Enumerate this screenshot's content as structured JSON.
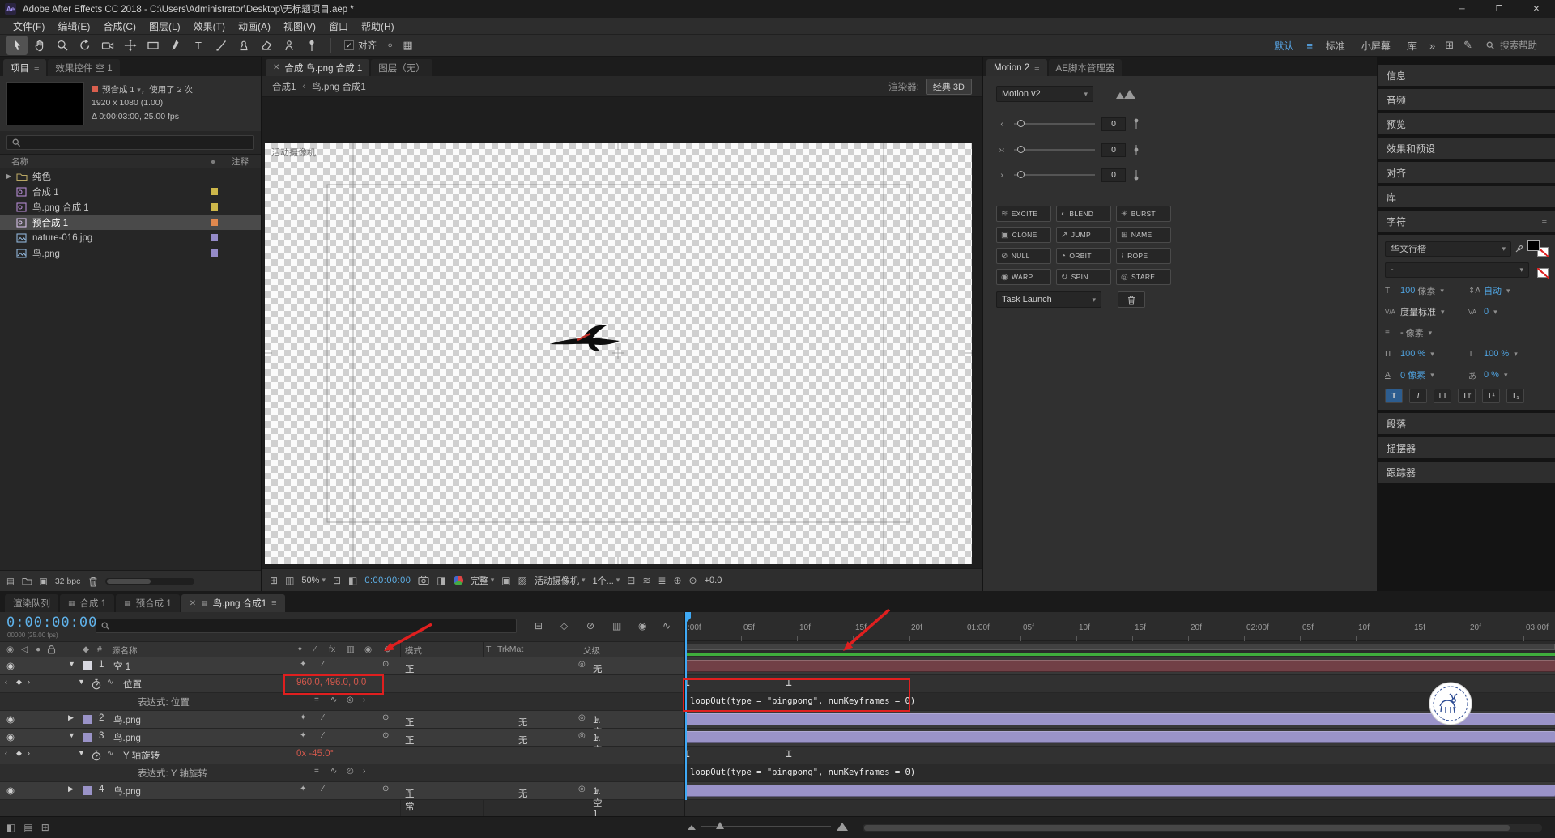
{
  "window": {
    "title": "Adobe After Effects CC 2018 - C:\\Users\\Administrator\\Desktop\\无标题项目.aep *",
    "app_badge": "Ae"
  },
  "menu": {
    "items": [
      "文件(F)",
      "编辑(E)",
      "合成(C)",
      "图层(L)",
      "效果(T)",
      "动画(A)",
      "视图(V)",
      "窗口",
      "帮助(H)"
    ]
  },
  "toolbar": {
    "snap_label": "对齐",
    "workspaces": [
      "默认",
      "标准",
      "小屏幕",
      "库"
    ],
    "overflow": "»",
    "search_placeholder": "搜索帮助"
  },
  "project": {
    "tab_project": "项目",
    "tab_effects": "效果控件 空 1",
    "info": {
      "chip": "#d95f4e",
      "name": "预合成 1",
      "usage": "，使用了 2 次",
      "line2": "1920 x 1080 (1.00)",
      "line3": "Δ 0:00:03:00, 25.00 fps"
    },
    "columns": {
      "name": "名称",
      "comment": "注释"
    },
    "items": [
      {
        "name": "纯色",
        "type": "folder",
        "chip": ""
      },
      {
        "name": "合成 1",
        "type": "comp",
        "chip": "#cdb74a"
      },
      {
        "name": "鸟.png 合成 1",
        "type": "comp",
        "chip": "#cdb74a"
      },
      {
        "name": "预合成 1",
        "type": "comp",
        "chip": "#e0884e"
      },
      {
        "name": "nature-016.jpg",
        "type": "image",
        "chip": "#958bc8"
      },
      {
        "name": "鸟.png",
        "type": "image",
        "chip": "#958bc8"
      }
    ],
    "footer": {
      "bpc": "32 bpc"
    }
  },
  "viewer": {
    "tab1": "合成 鸟.png 合成 1",
    "tab2": "图层（无）",
    "crumb1": "合成1",
    "crumb2": "鸟.png 合成1",
    "renderer_label": "渲染器:",
    "renderer_value": "经典 3D",
    "view_label": "活动摄像机",
    "toolbar": {
      "zoom": "50%",
      "time": "0:00:00:00",
      "resolution": "完整",
      "camera": "活动摄像机",
      "views": "1个...",
      "exposure": "+0.0"
    }
  },
  "motion": {
    "tab1": "Motion 2",
    "tab2": "AE脚本管理器",
    "preset": "Motion v2",
    "slider_values": [
      "0",
      "0",
      "0"
    ],
    "buttons": [
      {
        "icon": "≋",
        "label": "EXCITE"
      },
      {
        "icon": "◐",
        "label": "BLEND"
      },
      {
        "icon": "✳",
        "label": "BURST"
      },
      {
        "icon": "▣",
        "label": "CLONE"
      },
      {
        "icon": "↗",
        "label": "JUMP"
      },
      {
        "icon": "⊞",
        "label": "NAME"
      },
      {
        "icon": "⊘",
        "label": "NULL"
      },
      {
        "icon": "◔",
        "label": "ORBIT"
      },
      {
        "icon": "≀",
        "label": "ROPE"
      },
      {
        "icon": "◉",
        "label": "WARP"
      },
      {
        "icon": "↻",
        "label": "SPIN"
      },
      {
        "icon": "◎",
        "label": "STARE"
      }
    ],
    "task_launch": "Task Launch"
  },
  "sidebar": {
    "panels_top": [
      "信息",
      "音频",
      "预览",
      "效果和预设",
      "对齐",
      "库"
    ],
    "character": {
      "title": "字符",
      "font": "华文行楷",
      "style": "-",
      "size": "100",
      "size_unit": "像素",
      "leading": "自动",
      "kerning_label": "度量标准",
      "tracking": "0",
      "stroke_width": "-",
      "stroke_unit": "像素",
      "vscale": "100 %",
      "hscale": "100 %",
      "baseline": "0 像素",
      "tsume": "0 %"
    },
    "panels_bottom": [
      "段落",
      "摇摆器",
      "跟踪器"
    ]
  },
  "timeline": {
    "tabs": [
      {
        "label": "渲染队列"
      },
      {
        "label": "合成 1"
      },
      {
        "label": "预合成 1"
      },
      {
        "label": "鸟.png 合成1"
      }
    ],
    "time": "0:00:00:00",
    "time_sub": "00000 (25.00 fps)",
    "headers": {
      "source": "源名称",
      "mode": "模式",
      "t": "T",
      "trkmat": "TrkMat",
      "parent": "父级"
    },
    "mode_value": "正常",
    "trkmat_none": "无",
    "layers": [
      {
        "num": "1",
        "name": "空 1",
        "parent": "无",
        "chip": "#d8d8e0"
      },
      {
        "num": "2",
        "name": "鸟.png",
        "parent": "1.空1",
        "chip": "#9a93c8"
      },
      {
        "num": "3",
        "name": "鸟.png",
        "parent": "1.空1",
        "chip": "#9a93c8"
      },
      {
        "num": "4",
        "name": "鸟.png",
        "parent": "1.空1",
        "chip": "#9a93c8"
      }
    ],
    "position_prop": {
      "name": "位置",
      "value": "960.0, 496.0, 0.0",
      "expr_label": "表达式: 位置"
    },
    "rotation_prop": {
      "name": "Y 轴旋转",
      "value": "0x -45.0°",
      "expr_label": "表达式: Y 轴旋转"
    },
    "expression": "loopOut(type = \"pingpong\", numKeyframes = 0)",
    "ruler": [
      ":00f",
      "05f",
      "10f",
      "15f",
      "20f",
      "01:00f",
      "05f",
      "10f",
      "15f",
      "20f",
      "02:00f",
      "05f",
      "10f",
      "15f",
      "20f",
      "03:00f"
    ]
  },
  "colors": {
    "accent_blue": "#4fa3e0",
    "time_blue": "#5fb2ea",
    "value_red": "#d0584c",
    "annotation_red": "#e01f1f",
    "cached_green": "#3fae3c",
    "label_purple": "#9a93c8",
    "label_maroon": "#714046",
    "label_white": "#d8d8e0"
  }
}
